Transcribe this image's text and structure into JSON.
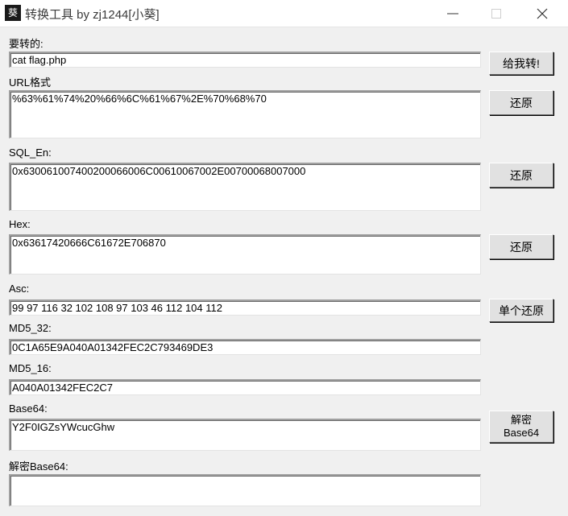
{
  "window": {
    "title": "转换工具 by zj1244[小葵]",
    "icon_glyph": "葵"
  },
  "input": {
    "label": "要转的:",
    "value": "cat flag.php",
    "button": "给我转!"
  },
  "url": {
    "label": "URL格式",
    "value": "%63%61%74%20%66%6C%61%67%2E%70%68%70",
    "button": "还原"
  },
  "sql_en": {
    "label": "SQL_En:",
    "value": "0x63006100740020006600 6C00610067002E00700068007000",
    "button": "还原"
  },
  "hex": {
    "label": "Hex:",
    "value": "0x63617420666C61672E706870",
    "button": "还原"
  },
  "asc": {
    "label": "Asc:",
    "value": "99 97 116 32 102 108 97 103 46 112 104 112",
    "button": "单个还原"
  },
  "md5_32": {
    "label": "MD5_32:",
    "value": "0C1A65E9A040A01342FEC2C793469DE3"
  },
  "md5_16": {
    "label": "MD5_16:",
    "value": "A040A01342FEC2C7"
  },
  "base64": {
    "label": "Base64:",
    "value": "Y2F0IGZsYWcucGhw",
    "button_line1": "解密",
    "button_line2": "Base64"
  },
  "decoded_base64": {
    "label": "解密Base64:",
    "value": ""
  }
}
